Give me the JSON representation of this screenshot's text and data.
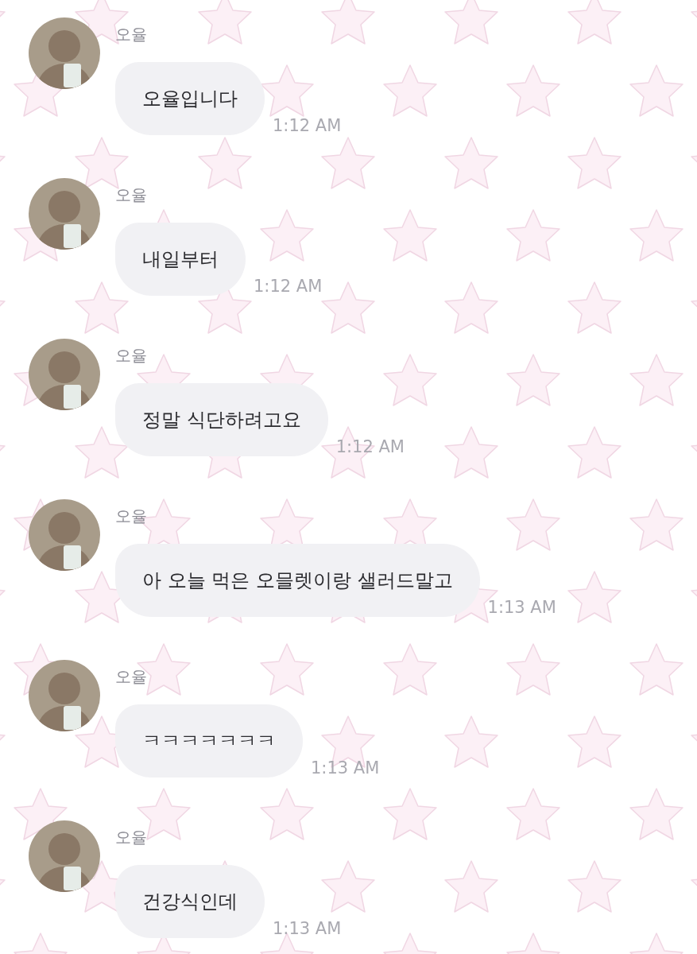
{
  "messages": [
    {
      "sender": "오율",
      "text": "오율입니다",
      "time": "1:12 AM"
    },
    {
      "sender": "오율",
      "text": "내일부터",
      "time": "1:12 AM"
    },
    {
      "sender": "오율",
      "text": "정말 식단하려고요",
      "time": "1:12 AM"
    },
    {
      "sender": "오율",
      "text": "아 오늘 먹은 오믈렛이랑 샐러드말고",
      "time": "1:13 AM"
    },
    {
      "sender": "오율",
      "text": "ㅋㅋㅋㅋㅋㅋㅋ",
      "time": "1:13 AM"
    },
    {
      "sender": "오율",
      "text": "건강식인데",
      "time": "1:13 AM"
    }
  ]
}
